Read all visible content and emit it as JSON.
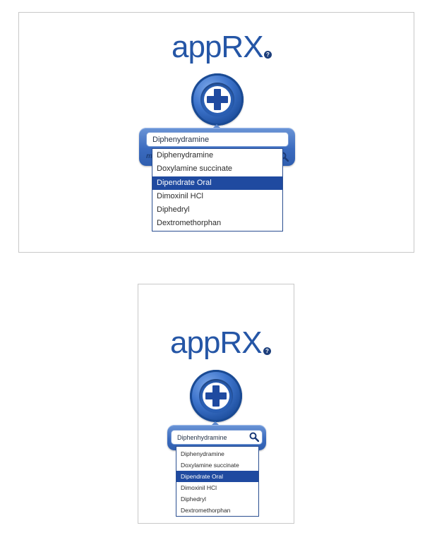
{
  "app": {
    "logo_text": "appRX",
    "help_glyph": "?",
    "brand_color": "#2556a6",
    "selected_color": "#1f4aa0"
  },
  "desktop": {
    "search": {
      "value": "Diphenydramine",
      "placeholder": ""
    },
    "peek_text": "m",
    "dropdown": {
      "items": [
        "Diphenydramine",
        "Doxylamine succinate",
        "Dipendrate Oral",
        "Dimoxinil HCl",
        "Diphedryl",
        "Dextromethorphan"
      ],
      "selected_index": 2
    }
  },
  "mobile": {
    "search": {
      "value": "Diphenhydramine",
      "placeholder": ""
    },
    "dropdown": {
      "items": [
        "Diphenydramine",
        "Doxylamine succinate",
        "Dipendrate Oral",
        "Dimoxinil HCl",
        "Diphedryl",
        "Dextromethorphan"
      ],
      "selected_index": 2
    }
  },
  "icons": {
    "cross": "plus-cross-icon",
    "search": "search-icon",
    "help": "help-icon"
  }
}
